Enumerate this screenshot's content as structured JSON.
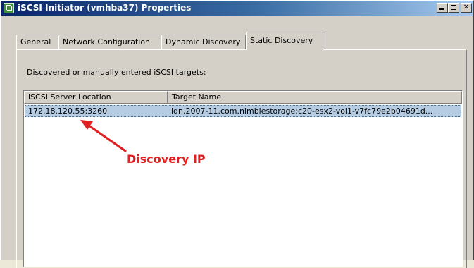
{
  "window": {
    "title": "iSCSI Initiator (vmhba37) Properties",
    "icon": "vmware-app-icon",
    "buttons": [
      "minimize",
      "maximize",
      "close"
    ]
  },
  "tabs": [
    {
      "label": "General",
      "active": false
    },
    {
      "label": "Network Configuration",
      "active": false
    },
    {
      "label": "Dynamic Discovery",
      "active": false
    },
    {
      "label": "Static Discovery",
      "active": true
    }
  ],
  "static_discovery": {
    "description": "Discovered or manually entered iSCSI targets:",
    "columns": [
      "iSCSI Server Location",
      "Target Name"
    ],
    "rows": [
      {
        "server_location": "172.18.120.55:3260",
        "target_name": "iqn.2007-11.com.nimblestorage:c20-esx2-vol1-v7fc79e2b04691d...",
        "selected": true
      }
    ]
  },
  "annotation": {
    "text": "Discovery IP",
    "color": "#e02020"
  },
  "colors": {
    "titlebar_start": "#0a246a",
    "titlebar_end": "#a6caf0",
    "selection": "#b5cce3",
    "window_face": "#d4d0c8"
  }
}
